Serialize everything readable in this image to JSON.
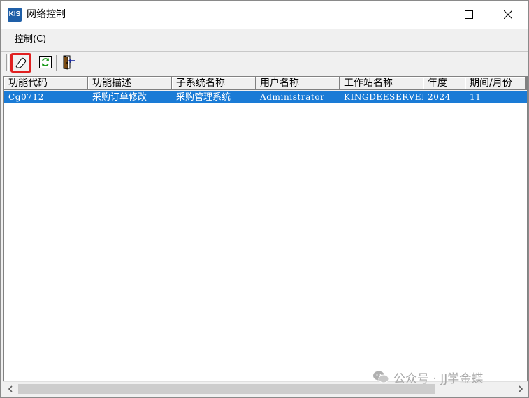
{
  "window": {
    "title": "网络控制",
    "icon_text": "KIS"
  },
  "menu": {
    "items": [
      {
        "label": "控制(C)"
      }
    ]
  },
  "toolbar": {
    "buttons": [
      {
        "name": "clear",
        "icon": "eraser-icon",
        "highlighted": true
      },
      {
        "name": "refresh",
        "icon": "refresh-icon"
      },
      {
        "name": "exit",
        "icon": "exit-door-icon"
      }
    ]
  },
  "table": {
    "columns": [
      "功能代码",
      "功能描述",
      "子系统名称",
      "用户名称",
      "工作站名称",
      "年度",
      "期间/月份"
    ],
    "rows": [
      [
        "Cg0712",
        "采购订单修改",
        "采购管理系统",
        "Administrator",
        "KINGDEESERVER",
        "2024",
        "11"
      ]
    ],
    "selected_row": 0
  },
  "watermark": {
    "text": "公众号 · JJ学金蝶"
  },
  "colors": {
    "selection": "#1a7bd6",
    "highlight_border": "#e02020",
    "window_bg": "#f0f0f0"
  }
}
